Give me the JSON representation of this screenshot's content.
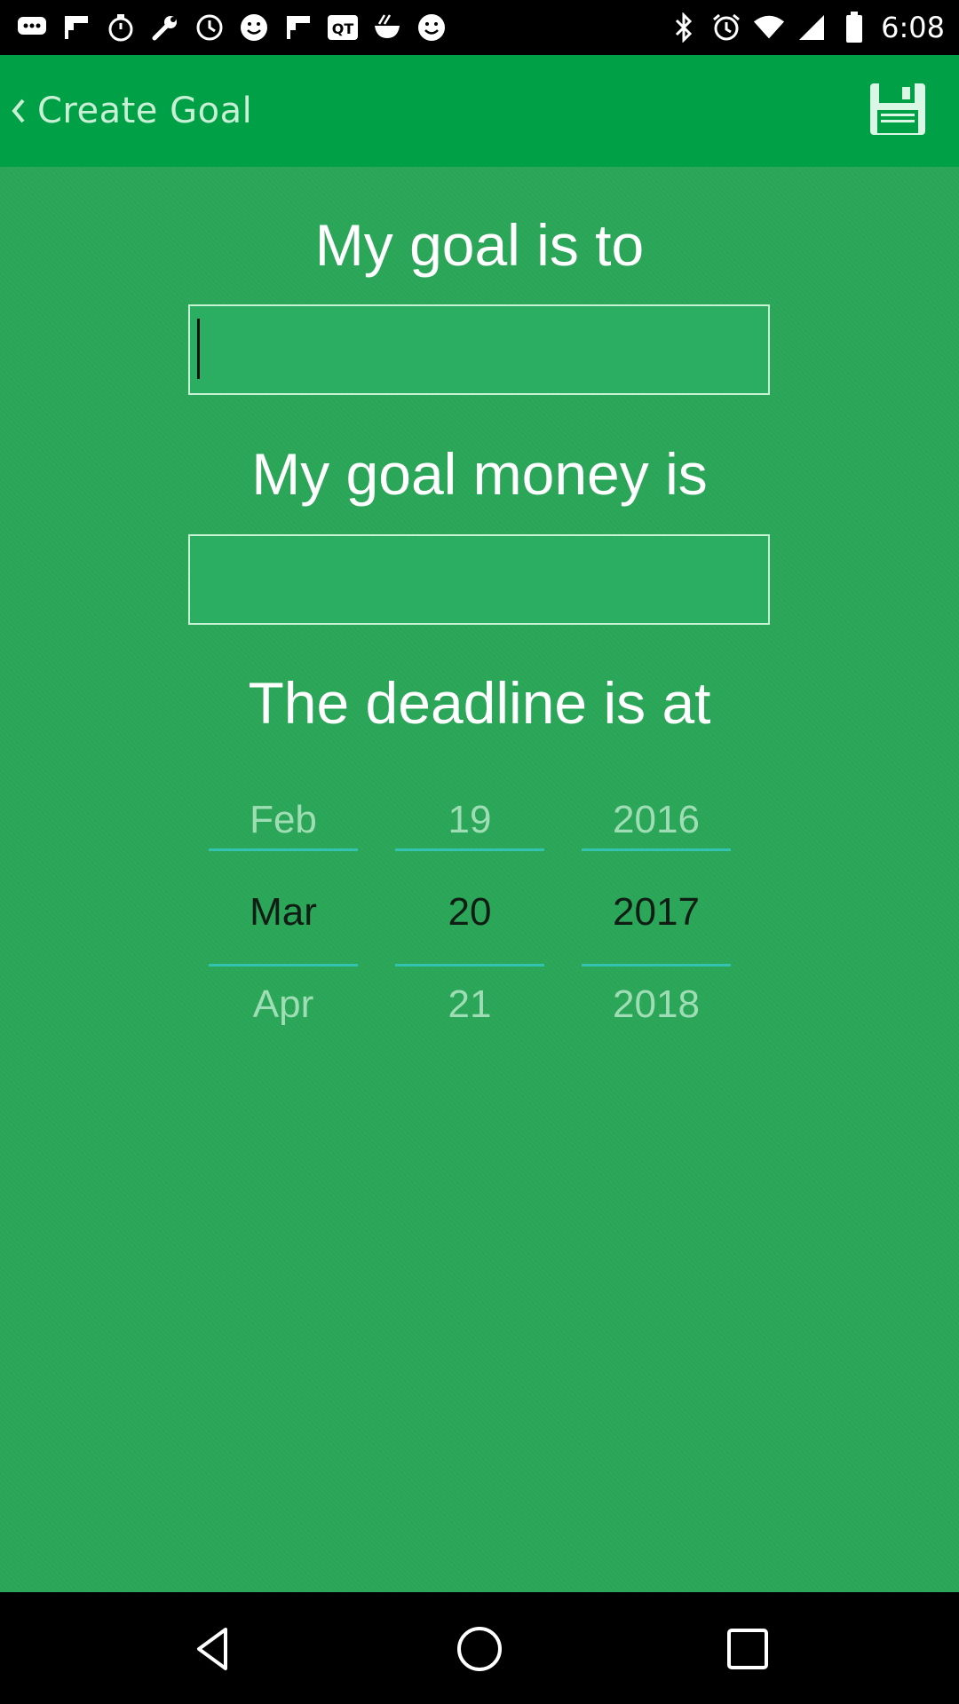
{
  "status_bar": {
    "time": "6:08",
    "icons": [
      "chat-icon",
      "flipboard-icon",
      "timer-icon",
      "wrench-icon",
      "clock-icon",
      "smiley-icon",
      "flipboard-icon",
      "qr-icon",
      "rice-bowl-icon",
      "smiley-icon",
      "bluetooth-icon",
      "alarm-icon",
      "wifi-icon",
      "signal-icon",
      "battery-icon"
    ]
  },
  "app_bar": {
    "title": "Create Goal",
    "save_icon": "save-icon"
  },
  "form": {
    "goal_label": "My goal is to",
    "goal_value": "",
    "money_label": "My goal money is",
    "money_value": "",
    "deadline_label": "The deadline is at"
  },
  "date_picker": {
    "month": {
      "prev": "Feb",
      "current": "Mar",
      "next": "Apr"
    },
    "day": {
      "prev": "19",
      "current": "20",
      "next": "21"
    },
    "year": {
      "prev": "2016",
      "current": "2017",
      "next": "2018"
    }
  },
  "nav_bar": {
    "icons": [
      "back-triangle-icon",
      "home-circle-icon",
      "recents-square-icon"
    ]
  },
  "colors": {
    "app_bar": "#00A046",
    "background": "#2DA85A",
    "field_border": "#C7F2D4",
    "picker_line": "#33C3B0"
  }
}
